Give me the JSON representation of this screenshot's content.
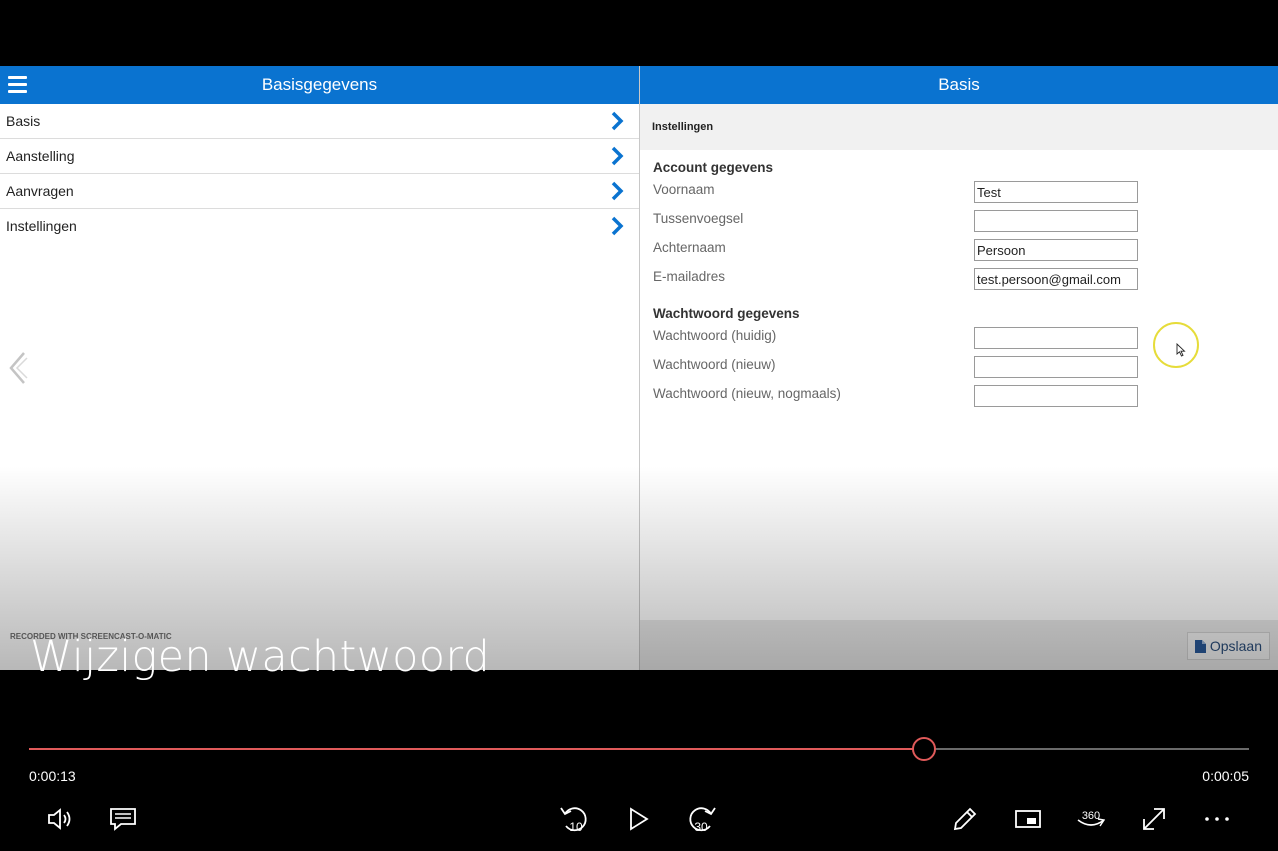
{
  "left_panel": {
    "title": "Basisgegevens",
    "items": [
      {
        "label": "Basis"
      },
      {
        "label": "Aanstelling"
      },
      {
        "label": "Aanvragen"
      },
      {
        "label": "Instellingen"
      }
    ]
  },
  "right_panel": {
    "title": "Basis",
    "section": "Instellingen",
    "account": {
      "title": "Account gegevens",
      "fields": [
        {
          "label": "Voornaam",
          "value": "Test"
        },
        {
          "label": "Tussenvoegsel",
          "value": ""
        },
        {
          "label": "Achternaam",
          "value": "Persoon"
        },
        {
          "label": "E-mailadres",
          "value": "test.persoon@gmail.com"
        }
      ]
    },
    "password": {
      "title": "Wachtwoord gegevens",
      "fields": [
        {
          "label": "Wachtwoord (huidig)",
          "value": ""
        },
        {
          "label": "Wachtwoord (nieuw)",
          "value": ""
        },
        {
          "label": "Wachtwoord (nieuw, nogmaals)",
          "value": ""
        }
      ]
    },
    "save_label": "Opslaan"
  },
  "watermark": "RECORDED WITH SCREENCAST-O-MATIC",
  "video": {
    "title": "Wijzigen wachtwoord",
    "elapsed": "0:00:13",
    "remaining": "0:00:05",
    "progress": 0.734,
    "skip_back_label": "10",
    "skip_forward_label": "30",
    "vr_label": "360"
  },
  "colors": {
    "header_blue": "#0a73d0",
    "seek_red": "#e05a5a",
    "cursor_highlight": "#e6dc3a"
  },
  "icons": [
    "menu-icon",
    "chevron-right-icon",
    "back-arrow-icon",
    "file-icon",
    "volume-icon",
    "captions-icon",
    "skip-back-icon",
    "play-icon",
    "skip-forward-icon",
    "edit-icon",
    "miniplayer-icon",
    "vr-360-icon",
    "fullscreen-icon",
    "more-icon"
  ]
}
